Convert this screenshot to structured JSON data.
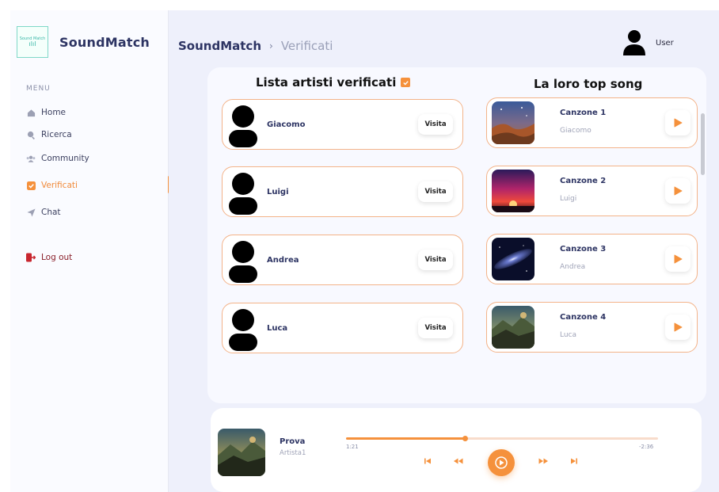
{
  "app": {
    "name": "SoundMatch",
    "logo_text": "Sound Match"
  },
  "sidebar": {
    "menu_label": "MENU",
    "items": [
      {
        "label": "Home",
        "icon": "home-icon"
      },
      {
        "label": "Ricerca",
        "icon": "search-icon"
      },
      {
        "label": "Community",
        "icon": "community-icon"
      },
      {
        "label": "Verificati",
        "icon": "verified-icon",
        "active": true
      },
      {
        "label": "Chat",
        "icon": "send-icon"
      }
    ],
    "logout_label": "Log out"
  },
  "header": {
    "breadcrumb_app": "SoundMatch",
    "breadcrumb_sep": "›",
    "breadcrumb_page": "Verificati",
    "user_label": "User"
  },
  "artists": {
    "title": "Lista artisti verificati",
    "visit_label": "Visita",
    "items": [
      {
        "name": "Giacomo"
      },
      {
        "name": "Luigi"
      },
      {
        "name": "Andrea"
      },
      {
        "name": "Luca"
      }
    ]
  },
  "songs": {
    "title": "La loro top song",
    "items": [
      {
        "title": "Canzone 1",
        "artist": "Giacomo"
      },
      {
        "title": "Canzone 2",
        "artist": "Luigi"
      },
      {
        "title": "Canzone 3",
        "artist": "Andrea"
      },
      {
        "title": "Canzone 4",
        "artist": "Luca"
      }
    ]
  },
  "player": {
    "title": "Prova",
    "artist": "Artista1",
    "elapsed": "1:21",
    "remaining": "-2:36",
    "progress": 0.38
  },
  "colors": {
    "accent": "#f5913c",
    "brand_text": "#2d3463",
    "card_border": "#f3b389"
  }
}
